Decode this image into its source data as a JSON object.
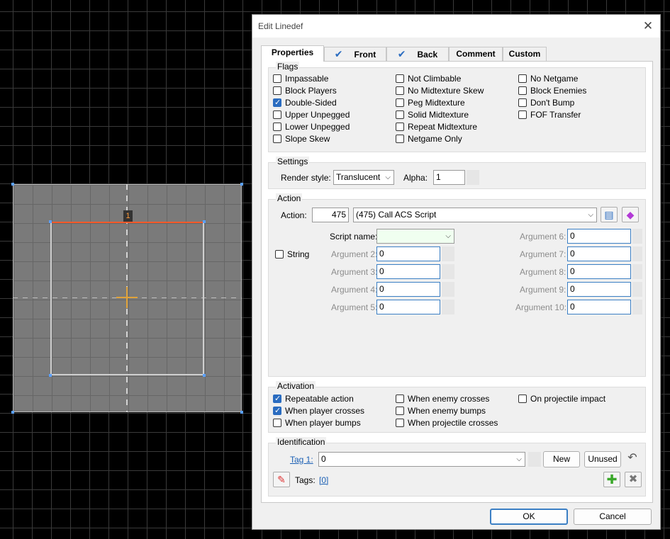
{
  "dialog": {
    "title": "Edit Linedef",
    "close_glyph": "✕"
  },
  "tabs": [
    {
      "label": "Properties",
      "checked": false
    },
    {
      "label": "Front",
      "checked": true
    },
    {
      "label": "Back",
      "checked": true
    },
    {
      "label": "Comment",
      "checked": false
    },
    {
      "label": "Custom",
      "checked": false
    }
  ],
  "map": {
    "linedef_number": "1"
  },
  "flags": {
    "label": "Flags",
    "items": [
      {
        "label": "Impassable",
        "checked": false
      },
      {
        "label": "Block Players",
        "checked": false
      },
      {
        "label": "Double-Sided",
        "checked": true
      },
      {
        "label": "Upper Unpegged",
        "checked": false
      },
      {
        "label": "Lower Unpegged",
        "checked": false
      },
      {
        "label": "Slope Skew",
        "checked": false
      },
      {
        "label": "Not Climbable",
        "checked": false
      },
      {
        "label": "No Midtexture Skew",
        "checked": false
      },
      {
        "label": "Peg Midtexture",
        "checked": false
      },
      {
        "label": "Solid Midtexture",
        "checked": false
      },
      {
        "label": "Repeat Midtexture",
        "checked": false
      },
      {
        "label": "Netgame Only",
        "checked": false
      },
      {
        "label": "No Netgame",
        "checked": false
      },
      {
        "label": "Block Enemies",
        "checked": false
      },
      {
        "label": "Don't Bump",
        "checked": false
      },
      {
        "label": "FOF Transfer",
        "checked": false
      }
    ]
  },
  "settings": {
    "label": "Settings",
    "render_style_label": "Render style:",
    "render_style_value": "Translucent",
    "alpha_label": "Alpha:",
    "alpha_value": "1"
  },
  "action": {
    "label": "Action",
    "action_label": "Action:",
    "action_number": "475",
    "action_name": "(475) Call ACS Script",
    "string_label": "String",
    "string_checked": false,
    "script_name_label": "Script name:",
    "script_name_value": "",
    "args_left": [
      {
        "label": "Argument 2:",
        "value": "0"
      },
      {
        "label": "Argument 3:",
        "value": "0"
      },
      {
        "label": "Argument 4:",
        "value": "0"
      },
      {
        "label": "Argument 5:",
        "value": "0"
      }
    ],
    "args_right": [
      {
        "label": "Argument 6:",
        "value": "0"
      },
      {
        "label": "Argument 7:",
        "value": "0"
      },
      {
        "label": "Argument 8:",
        "value": "0"
      },
      {
        "label": "Argument 9:",
        "value": "0"
      },
      {
        "label": "Argument 10:",
        "value": "0"
      }
    ]
  },
  "activation": {
    "label": "Activation",
    "items": [
      {
        "label": "Repeatable action",
        "checked": true
      },
      {
        "label": "When player crosses",
        "checked": true
      },
      {
        "label": "When player bumps",
        "checked": false
      },
      {
        "label": "When enemy crosses",
        "checked": false
      },
      {
        "label": "When enemy bumps",
        "checked": false
      },
      {
        "label": "When projectile crosses",
        "checked": false
      },
      {
        "label": "On projectile impact",
        "checked": false
      }
    ]
  },
  "identification": {
    "label": "Identification",
    "tag_label": "Tag 1:",
    "tag_value": "0",
    "new_label": "New",
    "unused_label": "Unused",
    "tags_label": "Tags:",
    "tags_value": "[0]"
  },
  "footer": {
    "ok_label": "OK",
    "cancel_label": "Cancel"
  },
  "colors": {
    "accent": "#2a6cc0",
    "selected_line": "#ff5a2a",
    "thing": "#e0a33a",
    "vertex": "#5aa0ff"
  }
}
